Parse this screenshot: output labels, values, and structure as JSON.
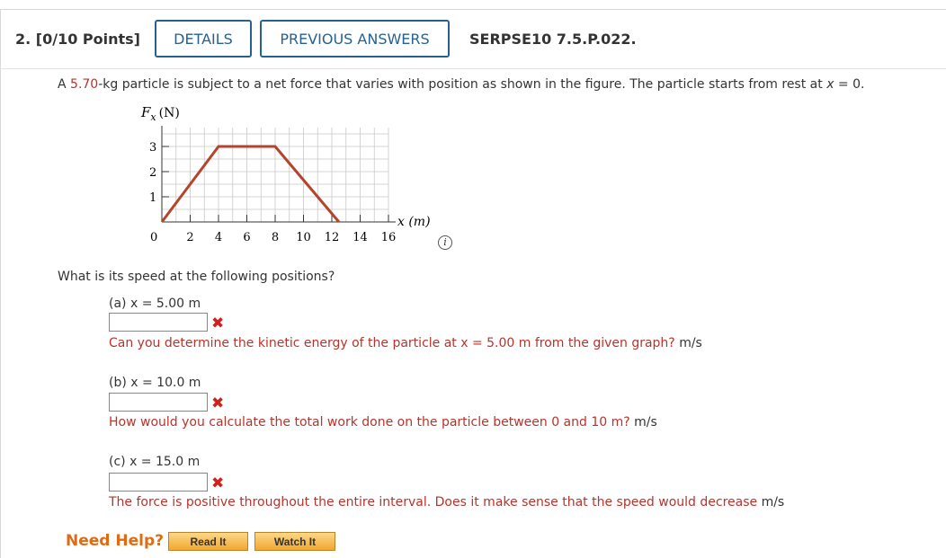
{
  "header": {
    "question_number": "2. [0/10 Points]",
    "details_label": "DETAILS",
    "previous_answers_label": "PREVIOUS ANSWERS",
    "question_code": "SERPSE10 7.5.P.022."
  },
  "intro": {
    "prefix": "A ",
    "mass": "5.70",
    "suffix": "-kg particle is subject to a net force that varies with position as shown in the figure. The particle starts from rest at ",
    "x_var": "x",
    "equals_zero": " = 0."
  },
  "graph": {
    "y_axis_label": "F",
    "y_axis_sub": "x",
    "y_axis_unit": "(N)",
    "x_axis_label": "x (m)",
    "origin_label": "0",
    "y_ticks": [
      "1",
      "2",
      "3"
    ],
    "x_ticks": [
      "2",
      "4",
      "6",
      "8",
      "10",
      "12",
      "14",
      "16"
    ],
    "line_color": "#b4442b",
    "points": [
      [
        0,
        0
      ],
      [
        4,
        3
      ],
      [
        8,
        3
      ],
      [
        12.5,
        0
      ]
    ]
  },
  "prompt": "What is its speed at the following positions?",
  "parts": [
    {
      "label": "(a) x = 5.00 m",
      "value": "",
      "feedback": "Can you determine the kinetic energy of the particle at x = 5.00 m from the given graph?",
      "units": "m/s"
    },
    {
      "label": "(b) x = 10.0 m",
      "value": "",
      "feedback": "How would you calculate the total work done on the particle between 0 and 10 m?",
      "units": "m/s"
    },
    {
      "label": "(c) x = 15.0 m",
      "value": "",
      "feedback": "The force is positive throughout the entire interval. Does it make sense that the speed would decrease",
      "units": "m/s"
    }
  ],
  "help": {
    "need_help": "Need Help?",
    "read_it": "Read It",
    "watch_it": "Watch It"
  },
  "colors": {
    "accent_blue": "#27618f",
    "error_red": "#b8332b",
    "help_orange": "#e06b14"
  }
}
